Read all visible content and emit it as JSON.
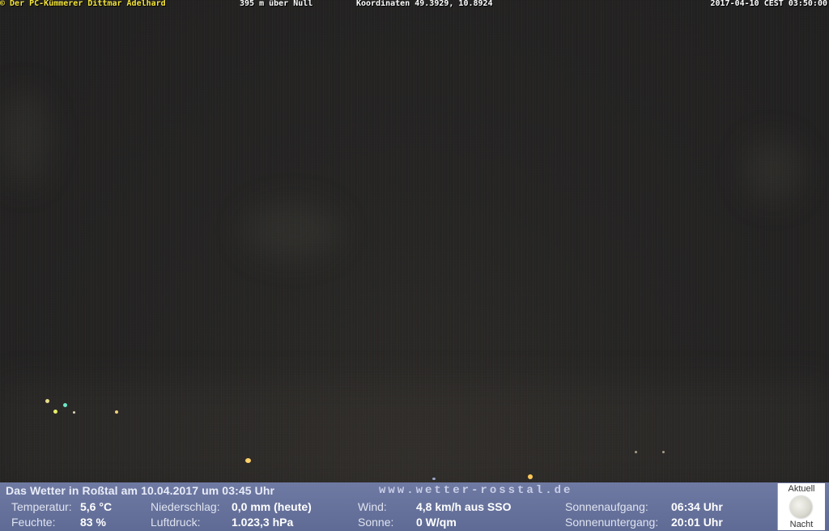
{
  "overlay": {
    "owner": "© Der PC-Kümmerer Dittmar Adelhard",
    "elevation": "395 m über Null",
    "coordinates": "Koordinaten 49.3929, 10.8924",
    "timestamp": "2017-04-10 CEST 03:50:00"
  },
  "weather_bar": {
    "title": "Das Wetter in Roßtal am 10.04.2017 um 03:45 Uhr",
    "website": "www.wetter-rosstal.de",
    "temperature_label": "Temperatur:",
    "temperature_value": "5,6 °C",
    "humidity_label": "Feuchte:",
    "humidity_value": "83 %",
    "precip_label": "Niederschlag:",
    "precip_value": "0,0 mm (heute)",
    "pressure_label": "Luftdruck:",
    "pressure_value": "1.023,3 hPa",
    "wind_label": "Wind:",
    "wind_value": "4,8 km/h aus SSO",
    "sun_label": "Sonne:",
    "sun_value": "0 W/qm",
    "sunrise_label": "Sonnenaufgang:",
    "sunrise_value": "06:34 Uhr",
    "sunset_label": "Sonnenuntergang:",
    "sunset_value": "20:01 Uhr"
  },
  "moon_panel": {
    "top_label": "Aktuell",
    "bottom_label": "Nacht",
    "icon": "full-moon-icon"
  },
  "colors": {
    "owner_text": "#f5e63a",
    "bar_background": "#6f7aa3"
  }
}
